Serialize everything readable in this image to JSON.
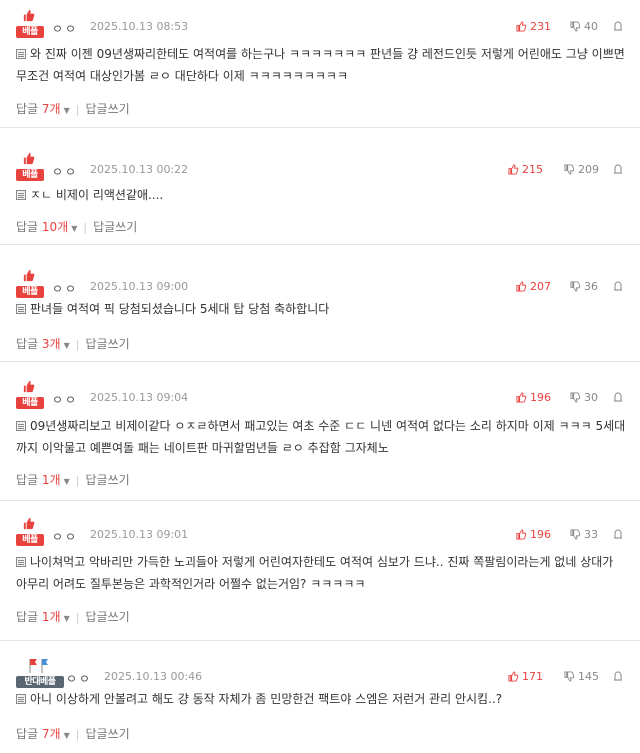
{
  "comments": [
    {
      "badge": "베플",
      "nick": "ㅇㅇ",
      "date": "2025.10.13 08:53",
      "up": "231",
      "down": "40",
      "text": "와 진짜 이젠 09년생짜리한테도 여적여를 하는구나 ㅋㅋㅋㅋㅋㅋㅋ 판년들 걍 레전드인듯 저렇게 어린애도 그냥 이쁘면 무조건 여적여 대상인가봄 ㄹㅇ 대단하다 이제 ㅋㅋㅋㅋㅋㅋㅋㅋㅋ",
      "reply_label": "답글",
      "reply_count": "7개",
      "write_reply": "답글쓰기"
    },
    {
      "badge": "베플",
      "nick": "ㅇㅇ",
      "date": "2025.10.13 00:22",
      "up": "215",
      "down": "209",
      "text": "ㅈㄴ 비제이 리액션같애....",
      "reply_label": "답글",
      "reply_count": "10개",
      "write_reply": "답글쓰기"
    },
    {
      "badge": "베플",
      "nick": "ㅇㅇ",
      "date": "2025.10.13 09:00",
      "up": "207",
      "down": "36",
      "text": "판녀들 여적여 픽 당첨되셨습니다 5세대 탑 당첨 축하합니다",
      "reply_label": "답글",
      "reply_count": "3개",
      "write_reply": "답글쓰기"
    },
    {
      "badge": "베플",
      "nick": "ㅇㅇ",
      "date": "2025.10.13 09:04",
      "up": "196",
      "down": "30",
      "text": "09년생짜리보고 비제이같다 ㅇㅈㄹ하면서 패고있는 여초 수준 ㄷㄷ 니넨 여적여 없다는 소리 하지마 이제 ㅋㅋㅋ 5세대까지 이악물고 예쁜여돌 패는 네이트판 마귀할멈년들 ㄹㅇ 추잡함 그자체노",
      "reply_label": "답글",
      "reply_count": "1개",
      "write_reply": "답글쓰기"
    },
    {
      "badge": "베플",
      "nick": "ㅇㅇ",
      "date": "2025.10.13 09:01",
      "up": "196",
      "down": "33",
      "text": "나이쳐먹고 악바리만 가득한 노괴들아 저렇게 어린여자한테도 여적여 심보가 드냐.. 진짜 쪽팔림이라는게 없네 상대가 아무리 어려도 질투본능은 과학적인거라 어쩔수 없는거임? ㅋㅋㅋㅋㅋ",
      "reply_label": "답글",
      "reply_count": "1개",
      "write_reply": "답글쓰기"
    },
    {
      "badge": "반대베플",
      "nick": "ㅇㅇ",
      "date": "2025.10.13 00:46",
      "up": "171",
      "down": "145",
      "text": "아니 이상하게 안볼려고 해도 걍 동작 자체가 좀 민망한건 팩트야 스엠은 저런거 관리 안시킴..?",
      "reply_label": "답글",
      "reply_count": "7개",
      "write_reply": "답글쓰기"
    }
  ],
  "colors": {
    "accent": "#e8423f",
    "antibest": "#5b6673"
  }
}
